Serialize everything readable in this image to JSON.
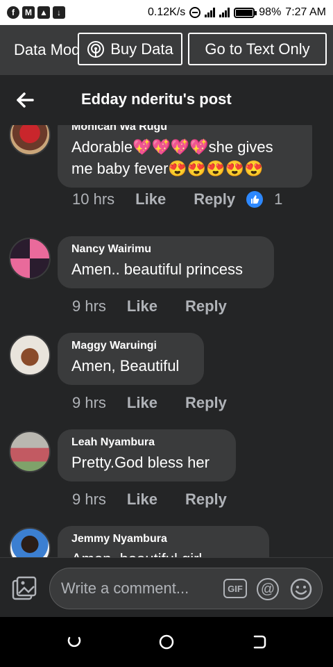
{
  "status_bar": {
    "network_speed": "0.12K/s",
    "battery_percent": "98%",
    "battery_level": 0.98,
    "time": "7:27 AM",
    "left_icons": [
      "facebook-icon",
      "gmail-icon",
      "gallery-icon",
      "download-icon"
    ]
  },
  "data_bar": {
    "mode_label": "Data Mode",
    "buy_data_label": "Buy Data",
    "text_only_label": "Go to Text Only"
  },
  "header": {
    "title": "Edday nderitu's post"
  },
  "comments": [
    {
      "name": "Monicah Wa Rugu",
      "text_line1": "Adorable💖💖💖💖she gives",
      "text_line2": "me baby fever😍😍😍😍😍",
      "time": "10 hrs",
      "like_label": "Like",
      "reply_label": "Reply",
      "reaction_count": "1"
    },
    {
      "name": "Nancy Wairimu",
      "text": "Amen.. beautiful princess",
      "time": "9 hrs",
      "like_label": "Like",
      "reply_label": "Reply"
    },
    {
      "name": "Maggy Waruingi",
      "text": "Amen, Beautiful",
      "time": "9 hrs",
      "like_label": "Like",
      "reply_label": "Reply"
    },
    {
      "name": "Leah Nyambura",
      "text": "Pretty.God bless her",
      "time": "9 hrs",
      "like_label": "Like",
      "reply_label": "Reply"
    },
    {
      "name": "Jemmy Nyambura",
      "text": "Amen, beautiful girl"
    }
  ],
  "composer": {
    "placeholder": "Write a comment...",
    "gif_label": "GIF"
  },
  "colors": {
    "background": "#242526",
    "bubble": "#3a3b3c",
    "meta_text": "#b0b3b8",
    "like_blue": "#2d88ff"
  }
}
